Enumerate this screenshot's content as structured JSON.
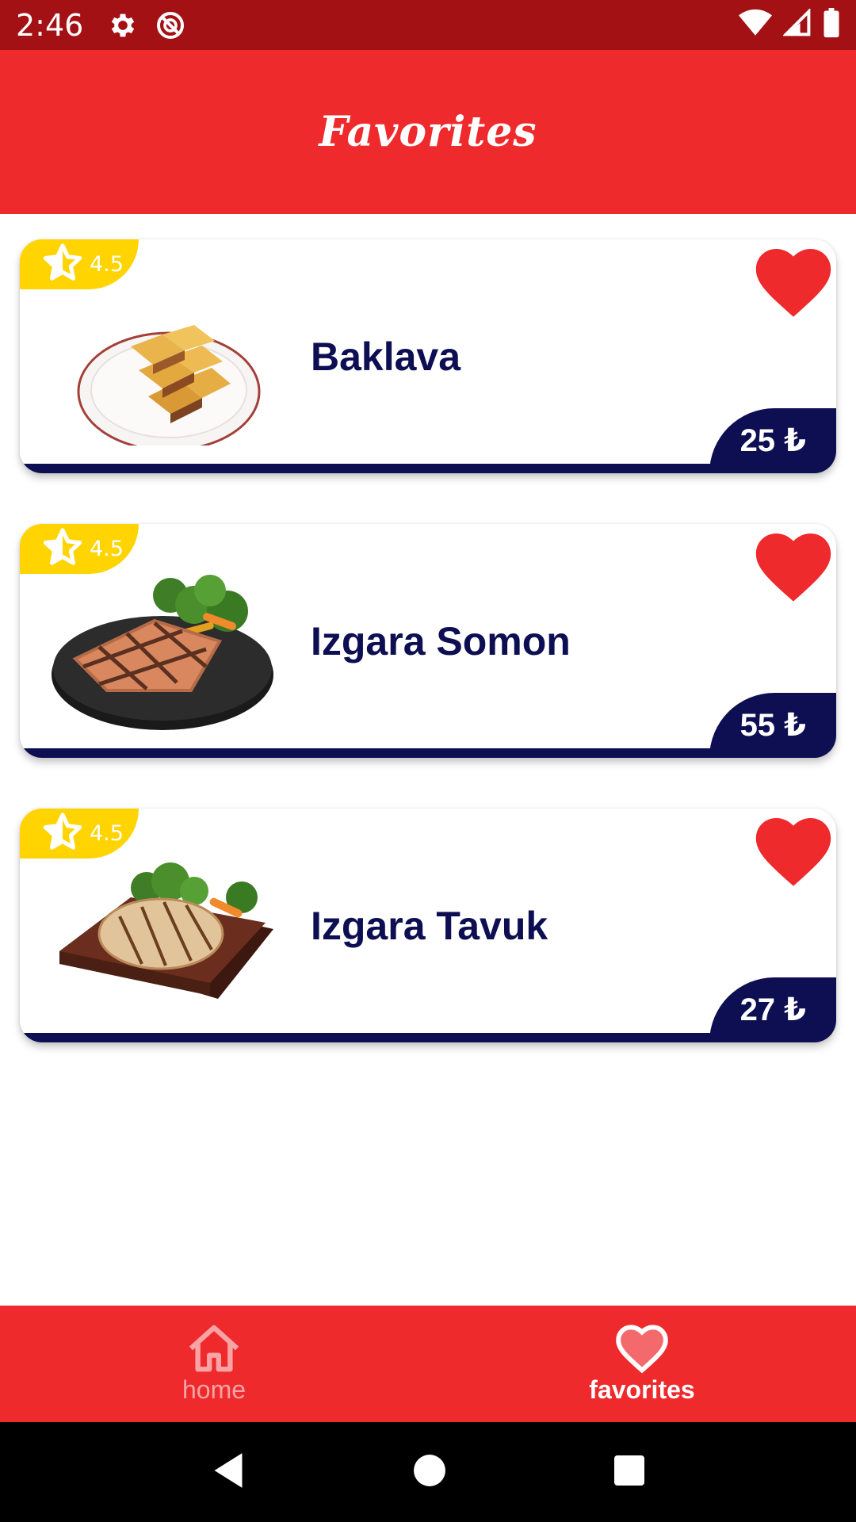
{
  "status_bar": {
    "time": "2:46",
    "left_icons": [
      "gear-icon",
      "no-disturb-icon"
    ],
    "right_icons": [
      "wifi-icon",
      "signal-icon",
      "battery-icon"
    ]
  },
  "app_bar": {
    "title": "Favorites"
  },
  "favorites": [
    {
      "name": "Baklava",
      "rating": "4.5",
      "price": "25 ₺",
      "image": "baklava-plate",
      "favorited": true
    },
    {
      "name": "Izgara Somon",
      "rating": "4.5",
      "price": "55 ₺",
      "image": "grilled-salmon-plate",
      "favorited": true
    },
    {
      "name": "Izgara Tavuk",
      "rating": "4.5",
      "price": "27 ₺",
      "image": "grilled-chicken-board",
      "favorited": true
    }
  ],
  "bottom_nav": {
    "items": [
      {
        "label": "home",
        "icon": "home-icon",
        "active": false
      },
      {
        "label": "favorites",
        "icon": "heart-icon",
        "active": true
      }
    ]
  },
  "colors": {
    "status_bar": "#a41114",
    "primary": "#ee2a2d",
    "navy": "#0d0f52",
    "rating_yellow": "#ffd400"
  }
}
